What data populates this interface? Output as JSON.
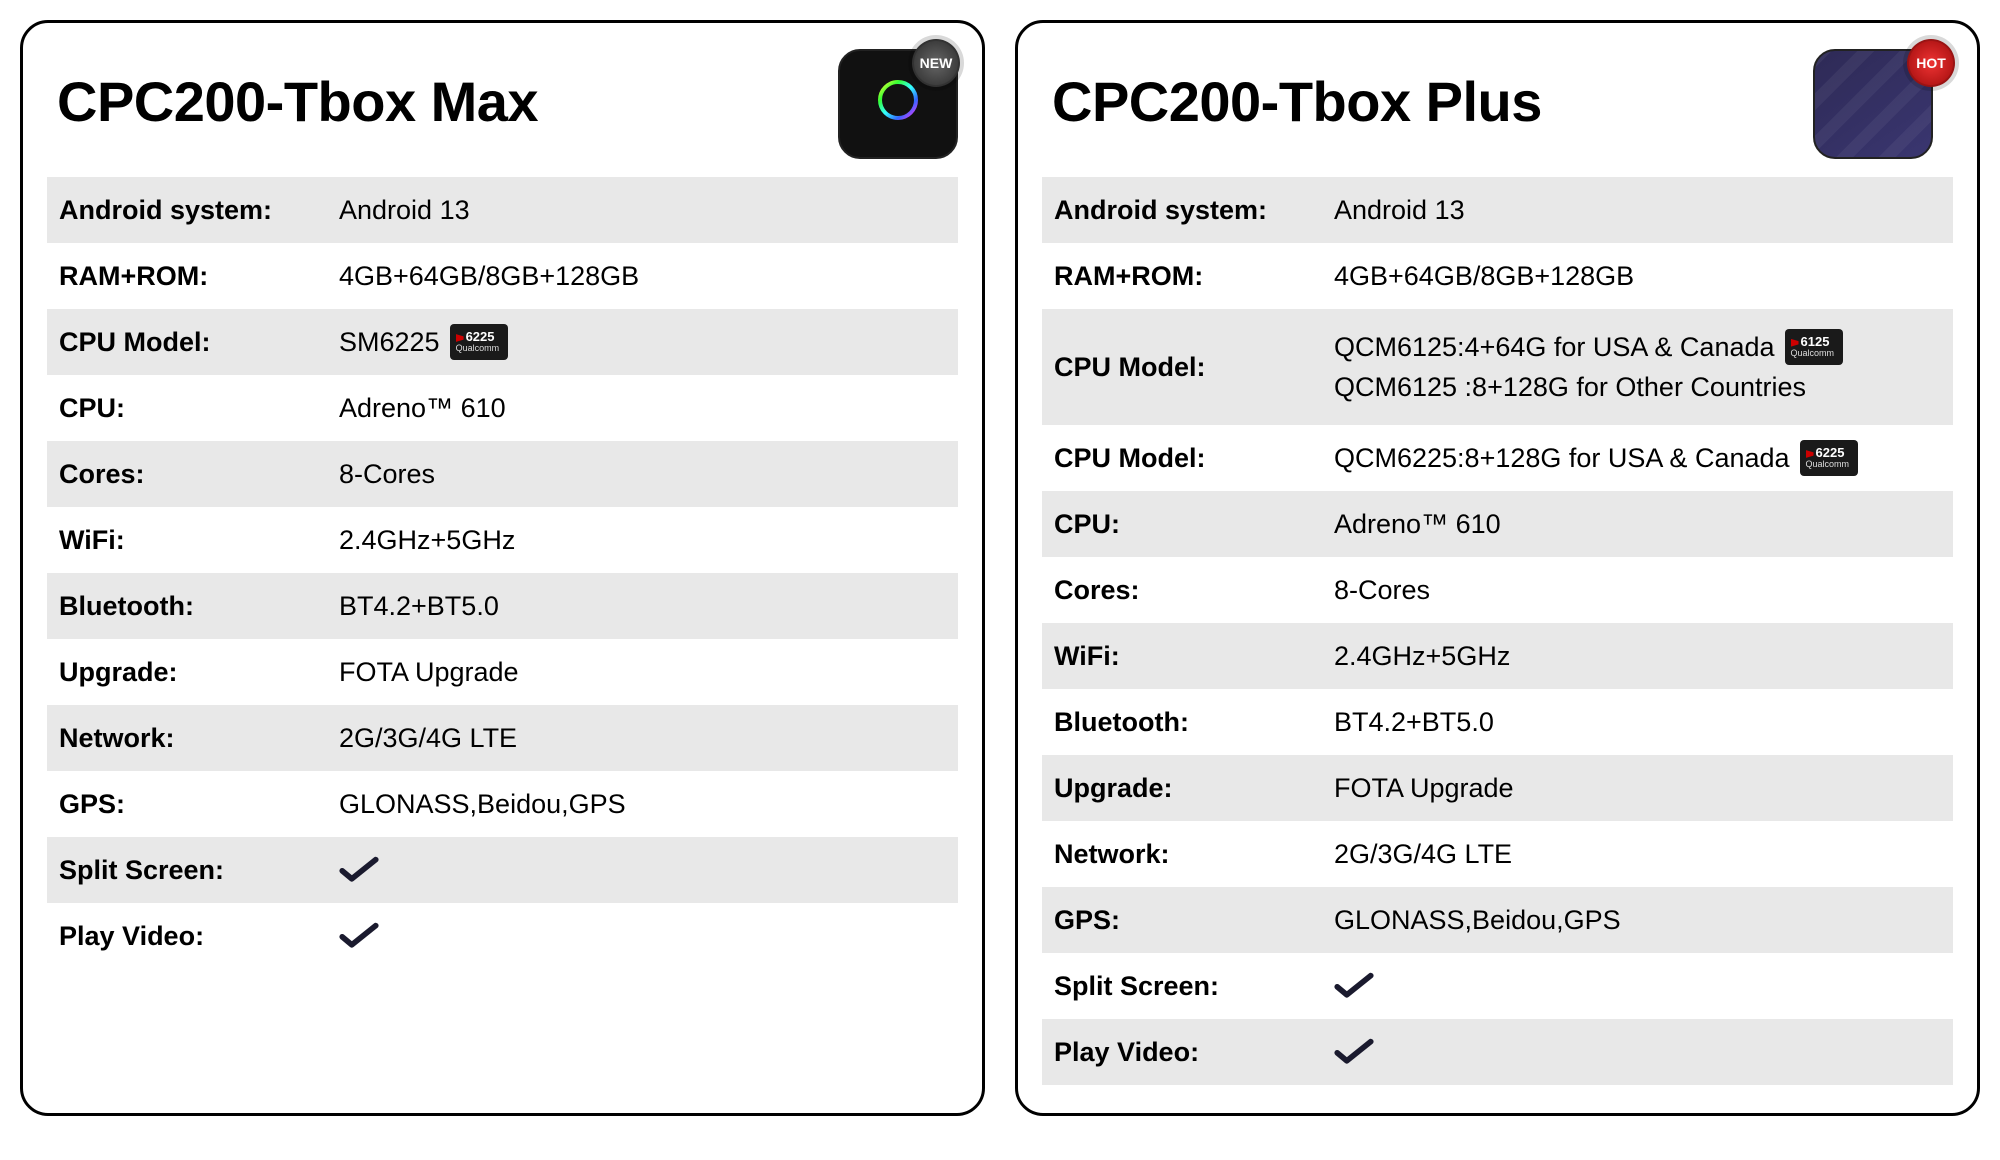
{
  "cards": [
    {
      "title": "CPC200-Tbox Max",
      "badge": "NEW",
      "rows": [
        {
          "label": "Android system:",
          "value": "Android 13"
        },
        {
          "label": "RAM+ROM:",
          "value": "4GB+64GB/8GB+128GB"
        },
        {
          "label": "CPU Model:",
          "value": "SM6225",
          "chip": "6225",
          "chipBrand": "Qualcomm"
        },
        {
          "label": "CPU:",
          "value": "Adreno™ 610"
        },
        {
          "label": "Cores:",
          "value": "8-Cores"
        },
        {
          "label": "WiFi:",
          "value": "2.4GHz+5GHz"
        },
        {
          "label": "Bluetooth:",
          "value": "BT4.2+BT5.0"
        },
        {
          "label": "Upgrade:",
          "value": "FOTA Upgrade"
        },
        {
          "label": "Network:",
          "value": "2G/3G/4G LTE"
        },
        {
          "label": "GPS:",
          "value": "GLONASS,Beidou,GPS"
        },
        {
          "label": "Split Screen:",
          "check": true
        },
        {
          "label": "Play Video:",
          "check": true
        }
      ]
    },
    {
      "title": "CPC200-Tbox Plus",
      "badge": "HOT",
      "rows": [
        {
          "label": "Android system:",
          "value": "Android 13"
        },
        {
          "label": "RAM+ROM:",
          "value": "4GB+64GB/8GB+128GB"
        },
        {
          "label": "CPU Model:",
          "multi": [
            {
              "text": "QCM6125:4+64G for USA & Canada",
              "chip": "6125",
              "chipBrand": "Qualcomm"
            },
            {
              "text": "QCM6125 :8+128G for Other Countries"
            }
          ]
        },
        {
          "label": "CPU Model:",
          "value": "QCM6225:8+128G for USA & Canada",
          "chip": "6225",
          "chipBrand": "Qualcomm"
        },
        {
          "label": "CPU:",
          "value": "Adreno™ 610"
        },
        {
          "label": "Cores:",
          "value": "8-Cores"
        },
        {
          "label": "WiFi:",
          "value": "2.4GHz+5GHz"
        },
        {
          "label": "Bluetooth:",
          "value": "BT4.2+BT5.0"
        },
        {
          "label": "Upgrade:",
          "value": "FOTA Upgrade"
        },
        {
          "label": "Network:",
          "value": "2G/3G/4G LTE"
        },
        {
          "label": "GPS:",
          "value": "GLONASS,Beidou,GPS"
        },
        {
          "label": "Split Screen:",
          "check": true
        },
        {
          "label": "Play Video:",
          "check": true
        }
      ]
    }
  ]
}
